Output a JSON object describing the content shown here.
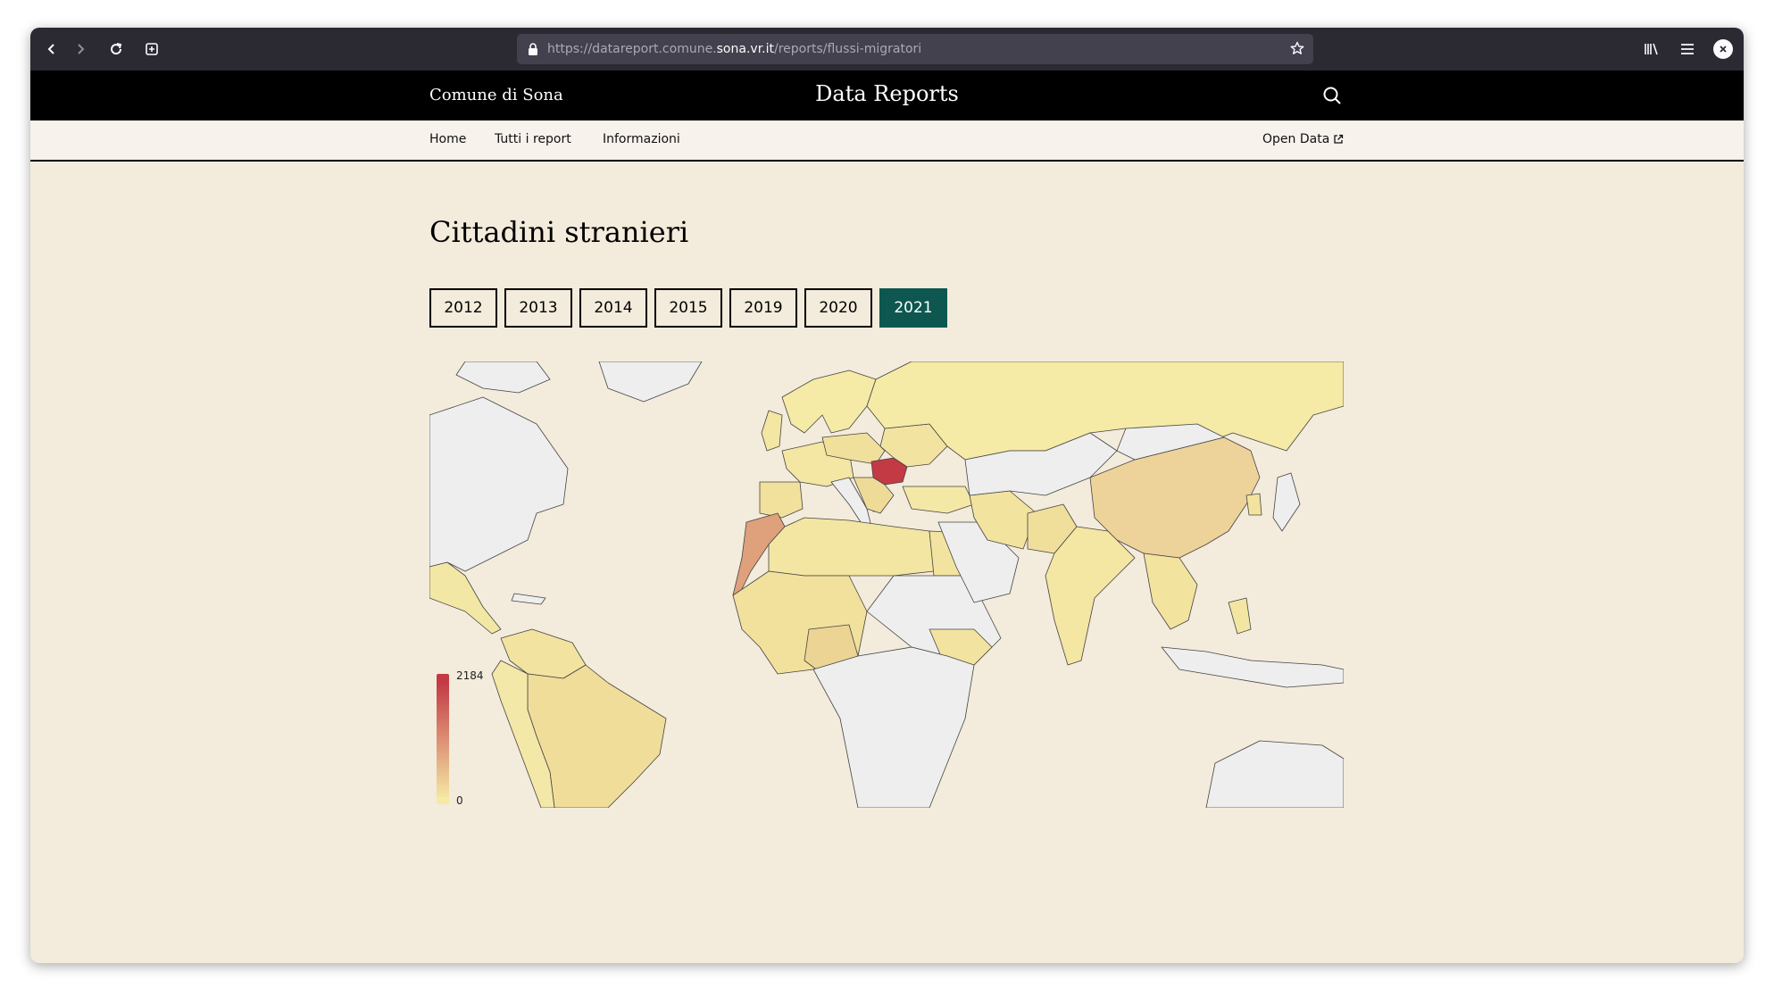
{
  "browser": {
    "url_prefix": "https://datareport.comune.",
    "url_host": "sona.vr.it",
    "url_path": "/reports/flussi-migratori"
  },
  "header": {
    "org_name": "Comune di Sona",
    "site_title": "Data Reports"
  },
  "nav": {
    "home": "Home",
    "all_reports": "Tutti i report",
    "info": "Informazioni",
    "open_data": "Open Data"
  },
  "page": {
    "title": "Cittadini stranieri"
  },
  "years": [
    "2012",
    "2013",
    "2014",
    "2015",
    "2019",
    "2020",
    "2021"
  ],
  "selected_year": "2021",
  "colors": {
    "accent": "#0d5750",
    "scale_low": "#f5e9a4",
    "scale_high": "#c33a45",
    "no_data": "#eeeeee",
    "background": "#f3ebdb"
  },
  "map": {
    "legend_max": "2184",
    "legend_min": "0",
    "highlighted": [
      {
        "country": "Romania",
        "level": 1.0
      },
      {
        "country": "Morocco",
        "level": 0.55
      },
      {
        "country": "China",
        "level": 0.3
      },
      {
        "country": "Albania",
        "level": 0.6
      },
      {
        "country": "Nigeria",
        "level": 0.25
      },
      {
        "country": "Brazil",
        "level": 0.12
      },
      {
        "country": "India",
        "level": 0.15
      },
      {
        "country": "Ukraine",
        "level": 0.12
      },
      {
        "country": "Russia",
        "level": 0.08
      }
    ]
  }
}
